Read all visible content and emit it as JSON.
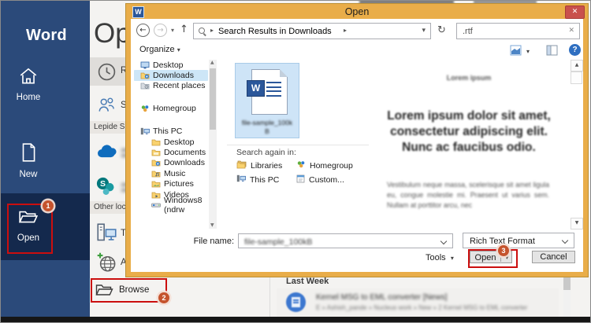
{
  "colors": {
    "sidebar_blue": "#2B4A7A",
    "sidebar_selected_blue": "#14294D",
    "dialog_gold": "#E9AD49",
    "annotation_red": "#CB0E0E",
    "badge_orange": "#C5532D",
    "selection_blue": "#CDE6F7",
    "word_blue": "#2B579A",
    "close_button_red": "#C9504C",
    "help_blue": "#2F6FC1"
  },
  "annotations": {
    "badge1": "1",
    "badge2": "2",
    "badge3": "3"
  },
  "sidebar": {
    "app_title": "Word",
    "items": [
      {
        "label": "Home"
      },
      {
        "label": "New"
      },
      {
        "label": "Open"
      }
    ]
  },
  "backstage": {
    "title": "Open",
    "nav_recent": "Recent",
    "nav_shared": "Shared with Me",
    "section1_header": "Lepide Soft",
    "section2_header": "Other locations",
    "nav_thispc": "This PC",
    "nav_addplace": "Add a Place",
    "browse_label": "Browse",
    "recent_panel": {
      "header": "Last Week",
      "item_title": "Kernel MSG to EML converter [News]",
      "item_path": "E » Ashish_pande » Nucleus work » New » 2 Kernel MSG to EML converter"
    }
  },
  "dialog": {
    "window_title": "Open",
    "address_crumb": "Search Results in Downloads",
    "search_value": ".rtf",
    "organize_label": "Organize",
    "tree": [
      {
        "label": "Desktop"
      },
      {
        "label": "Downloads"
      },
      {
        "label": "Recent places"
      },
      {
        "label": "Homegroup"
      },
      {
        "label": "This PC"
      },
      {
        "label": "Desktop"
      },
      {
        "label": "Documents"
      },
      {
        "label": "Downloads"
      },
      {
        "label": "Music"
      },
      {
        "label": "Pictures"
      },
      {
        "label": "Videos"
      },
      {
        "label": "Windows8 (ndrw"
      }
    ],
    "file_tile": {
      "label_line1": "file-sample_100k",
      "label_line2": "B"
    },
    "search_again": {
      "header": "Search again in:",
      "options": [
        {
          "label": "Libraries"
        },
        {
          "label": "Homegroup"
        },
        {
          "label": "This PC"
        },
        {
          "label": "Custom..."
        }
      ]
    },
    "preview": {
      "heading": "Lorem ipsum",
      "lead": "Lorem ipsum dolor sit amet, consectetur adipiscing elit. Nunc ac faucibus odio.",
      "body": "Vestibulum neque massa, scelerisque sit amet ligula eu, congue molestie mi. Praesent ut varius sem. Nullam at porttitor arcu, nec"
    },
    "footer": {
      "file_name_label": "File name:",
      "file_name_value": "file-sample_100kB",
      "file_type_value": "Rich Text Format",
      "tools_label": "Tools",
      "open_label": "Open",
      "cancel_label": "Cancel"
    }
  },
  "icons": {
    "close": "✕",
    "back": "←",
    "forward": "→",
    "up": "↑",
    "refresh": "↻",
    "crumb_sep": "▸",
    "dropdown": "▾",
    "clear": "✕",
    "scroll_up": "▲",
    "scroll_down": "▼"
  }
}
